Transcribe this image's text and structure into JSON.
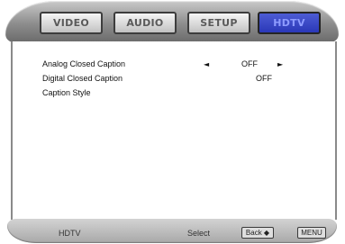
{
  "tabs": [
    {
      "label": "VIDEO"
    },
    {
      "label": "AUDIO"
    },
    {
      "label": "SETUP"
    },
    {
      "label": "HDTV"
    }
  ],
  "menu": {
    "rows": [
      {
        "label": "Analog Closed Caption",
        "value": "OFF"
      },
      {
        "label": "Digital Closed Caption",
        "value": "OFF"
      },
      {
        "label": "Caption Style"
      }
    ],
    "left_arrow": "◄",
    "right_arrow": "►"
  },
  "footer": {
    "title": "HDTV",
    "select": "Select",
    "keys_label": "Back ◆",
    "menu_label": "MENU"
  },
  "colors": {
    "active_tab": "#3344c7",
    "bezel": "#8d8d8d"
  }
}
